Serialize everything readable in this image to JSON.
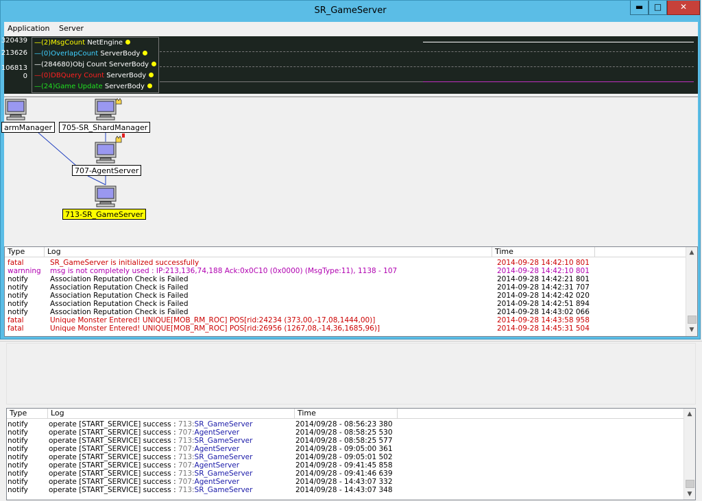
{
  "window": {
    "title": "SR_GameServer",
    "controls": {
      "minimize": "▬",
      "maximize": "□",
      "close": "✕"
    }
  },
  "menu": [
    "Application",
    "Server"
  ],
  "graph": {
    "y_labels": [
      "320439",
      "213626",
      "106813",
      "0"
    ],
    "legend": [
      {
        "label": "(2)MsgCount",
        "source": "NetEngine",
        "color": "#ffff00"
      },
      {
        "label": "(0)OverlapCount",
        "source": "ServerBody",
        "color": "#3fd0ff"
      },
      {
        "label": "(284680)Obj Count",
        "source": "ServerBody",
        "color": "#ffffff"
      },
      {
        "label": "(0)DBQuery Count",
        "source": "ServerBody",
        "color": "#ff2020"
      },
      {
        "label": "(24)Game Update",
        "source": "ServerBody",
        "color": "#20e020"
      }
    ]
  },
  "topology": {
    "nodes": [
      {
        "label": "armManager"
      },
      {
        "label": "705-SR_ShardManager"
      },
      {
        "label": "707-AgentServer"
      },
      {
        "label": "713-SR_GameServer"
      }
    ]
  },
  "log_top": {
    "columns": [
      "Type",
      "Log",
      "Time"
    ],
    "rows": [
      {
        "type": "fatal",
        "log": "SR_GameServer is initialized successfully",
        "time": "2014-09-28 14:42:10 801",
        "color": "#cc0000"
      },
      {
        "type": "warnning",
        "log": "msg is not completely used : IP:213,136,74,188 Ack:0x0C10 (0x0000) (MsgType:11), 1138 - 107",
        "time": "2014-09-28 14:42:10 801",
        "color": "#b000b0"
      },
      {
        "type": "notify",
        "log": "Association Reputation Check is Failed",
        "time": "2014-09-28 14:42:21 801",
        "color": "#000000"
      },
      {
        "type": "notify",
        "log": "Association Reputation Check is Failed",
        "time": "2014-09-28 14:42:31 707",
        "color": "#000000"
      },
      {
        "type": "notify",
        "log": "Association Reputation Check is Failed",
        "time": "2014-09-28 14:42:42 020",
        "color": "#000000"
      },
      {
        "type": "notify",
        "log": "Association Reputation Check is Failed",
        "time": "2014-09-28 14:42:51 894",
        "color": "#000000"
      },
      {
        "type": "notify",
        "log": "Association Reputation Check is Failed",
        "time": "2014-09-28 14:43:02 066",
        "color": "#000000"
      },
      {
        "type": "fatal",
        "log": "Unique Monster Entered! UNIQUE[MOB_RM_ROC] POS[rid:24234 (373,00,-17,08,1444,00)]",
        "time": "2014-09-28 14:43:58 958",
        "color": "#cc0000"
      },
      {
        "type": "fatal",
        "log": "Unique Monster Entered! UNIQUE[MOB_RM_ROC] POS[rid:26956 (1267,08,-14,36,1685,96)]",
        "time": "2014-09-28 14:45:31 504",
        "color": "#cc0000"
      }
    ]
  },
  "log_bottom": {
    "columns": [
      "Type",
      "Log",
      "Time"
    ],
    "rows": [
      {
        "type": "notify",
        "prefix": "operate [START_SERVICE] success : ",
        "id": "713:",
        "name": "SR_GameServer",
        "time": "2014/09/28 - 08:56:23 380"
      },
      {
        "type": "notify",
        "prefix": "operate [START_SERVICE] success : ",
        "id": "707:",
        "name": "AgentServer",
        "time": "2014/09/28 - 08:58:25 530"
      },
      {
        "type": "notify",
        "prefix": "operate [START_SERVICE] success : ",
        "id": "713:",
        "name": "SR_GameServer",
        "time": "2014/09/28 - 08:58:25 577"
      },
      {
        "type": "notify",
        "prefix": "operate [START_SERVICE] success : ",
        "id": "707:",
        "name": "AgentServer",
        "time": "2014/09/28 - 09:05:00 361"
      },
      {
        "type": "notify",
        "prefix": "operate [START_SERVICE] success : ",
        "id": "713:",
        "name": "SR_GameServer",
        "time": "2014/09/28 - 09:05:01 502"
      },
      {
        "type": "notify",
        "prefix": "operate [START_SERVICE] success : ",
        "id": "707:",
        "name": "AgentServer",
        "time": "2014/09/28 - 09:41:45 858"
      },
      {
        "type": "notify",
        "prefix": "operate [START_SERVICE] success : ",
        "id": "713:",
        "name": "SR_GameServer",
        "time": "2014/09/28 - 09:41:46 639"
      },
      {
        "type": "notify",
        "prefix": "operate [START_SERVICE] success : ",
        "id": "707:",
        "name": "AgentServer",
        "time": "2014/09/28 - 14:43:07 332"
      },
      {
        "type": "notify",
        "prefix": "operate [START_SERVICE] success : ",
        "id": "713:",
        "name": "SR_GameServer",
        "time": "2014/09/28 - 14:43:07 348"
      }
    ]
  },
  "scroll": {
    "up": "▲",
    "down": "▼"
  }
}
